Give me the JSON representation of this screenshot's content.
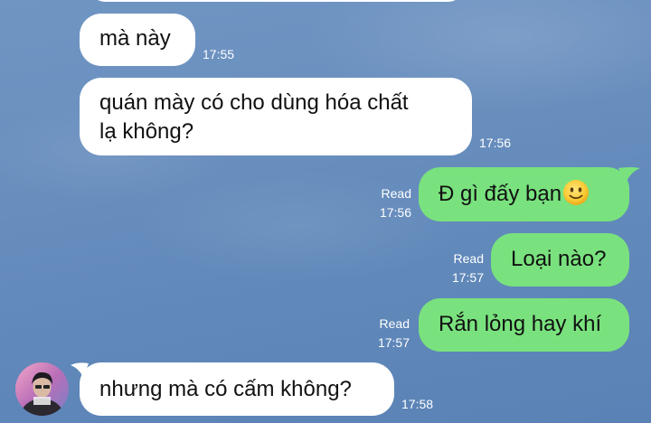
{
  "chat": {
    "messages": [
      {
        "direction": "incoming",
        "text": "mà này",
        "time": "17:55"
      },
      {
        "direction": "incoming",
        "text": "quán mày có cho dùng hóa chất lạ không?",
        "line1": "quán mày có cho dùng hóa chất",
        "line2": "lạ không?",
        "time": "17:56"
      },
      {
        "direction": "outgoing",
        "text": "Đ gì đấy bạn",
        "emoji": "slightly-smiling-face",
        "read": "Read",
        "time": "17:56"
      },
      {
        "direction": "outgoing",
        "text": "Loại nào?",
        "read": "Read",
        "time": "17:57"
      },
      {
        "direction": "outgoing",
        "text": "Rắn lỏng hay khí",
        "read": "Read",
        "time": "17:57"
      },
      {
        "direction": "incoming",
        "text": "nhưng mà có cấm không?",
        "time": "17:58",
        "avatar": "contact-avatar"
      }
    ]
  },
  "colors": {
    "incoming_bubble": "#ffffff",
    "outgoing_bubble": "#79e27e",
    "background": "#6b90bf",
    "meta_text": "#ffffff"
  }
}
